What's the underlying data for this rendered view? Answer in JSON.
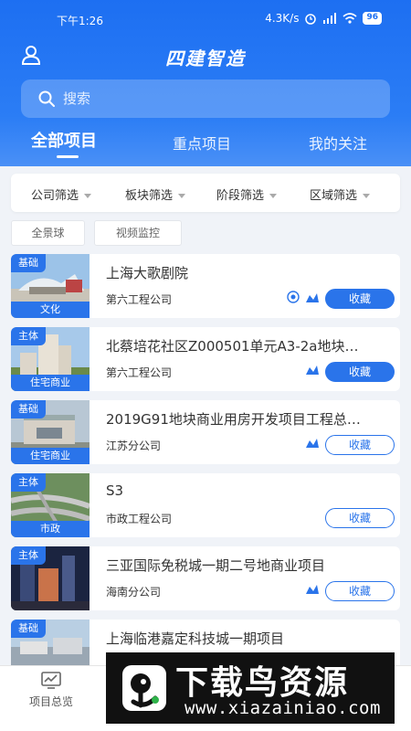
{
  "status_bar": {
    "time": "下午1:26",
    "speed": "4.3K/s",
    "battery": "96"
  },
  "header": {
    "app_title": "四建智造"
  },
  "search": {
    "placeholder": "搜索"
  },
  "tabs": [
    {
      "label": "全部项目",
      "active": true
    },
    {
      "label": "重点项目",
      "active": false
    },
    {
      "label": "我的关注",
      "active": false
    }
  ],
  "filters": [
    "公司筛选",
    "板块筛选",
    "阶段筛选",
    "区域筛选"
  ],
  "chips": [
    "全景球",
    "视频监控"
  ],
  "projects": [
    {
      "tag": "基础",
      "category": "文化",
      "title": "上海大歌剧院",
      "company": "第六工程公司",
      "fav_label": "收藏",
      "fav_filled": true,
      "icons": [
        "panorama-icon",
        "chart-icon"
      ]
    },
    {
      "tag": "主体",
      "category": "住宅商业",
      "title": "北蔡培花社区Z000501单元A3-2a地块…",
      "company": "第六工程公司",
      "fav_label": "收藏",
      "fav_filled": true,
      "icons": [
        "chart-icon"
      ]
    },
    {
      "tag": "基础",
      "category": "住宅商业",
      "title": "2019G91地块商业用房开发项目工程总…",
      "company": "江苏分公司",
      "fav_label": "收藏",
      "fav_filled": false,
      "icons": [
        "chart-icon"
      ]
    },
    {
      "tag": "主体",
      "category": "市政",
      "title": "S3",
      "company": "市政工程公司",
      "fav_label": "收藏",
      "fav_filled": false,
      "icons": []
    },
    {
      "tag": "主体",
      "category": "",
      "title": "三亚国际免税城一期二号地商业项目",
      "company": "海南分公司",
      "fav_label": "收藏",
      "fav_filled": false,
      "icons": [
        "chart-icon"
      ]
    },
    {
      "tag": "基础",
      "category": "",
      "title": "上海临港嘉定科技城一期项目",
      "company": "",
      "fav_label": "",
      "fav_filled": false,
      "icons": []
    }
  ],
  "bottom_nav": {
    "overview_label": "项目总览"
  },
  "watermark": {
    "text": "下载鸟资源",
    "url": "www.xiazainiao.com"
  },
  "colors": {
    "primary": "#1d6ff2",
    "button": "#2a74ea",
    "background": "#f0f3f8"
  }
}
